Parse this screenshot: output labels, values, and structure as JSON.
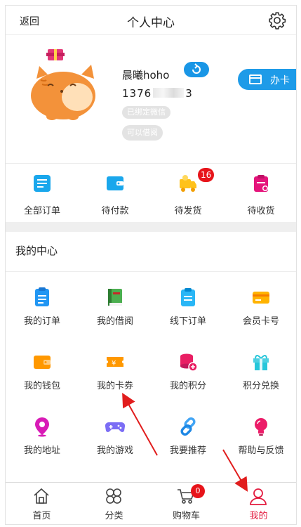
{
  "header": {
    "back_label": "返回",
    "title": "个人中心"
  },
  "profile": {
    "username": "晨曦hoho",
    "phone_prefix": "1376",
    "phone_suffix": "3",
    "tag_wechat": "已绑定微信",
    "tag_borrow": "可以借阅",
    "card_button_label": "办卡"
  },
  "orders": [
    {
      "label": "全部订单",
      "icon": "all-orders-icon",
      "color": "#1aa7ec"
    },
    {
      "label": "待付款",
      "icon": "wallet-icon",
      "color": "#1aa7ec"
    },
    {
      "label": "待发货",
      "icon": "delivery-truck-icon",
      "color": "#ffc21b",
      "badge": "16"
    },
    {
      "label": "待收货",
      "icon": "clipboard-icon",
      "color": "#e5147b"
    }
  ],
  "center": {
    "title": "我的中心",
    "items": [
      {
        "label": "我的订单",
        "icon": "order-list-icon"
      },
      {
        "label": "我的借阅",
        "icon": "book-icon"
      },
      {
        "label": "线下订单",
        "icon": "offline-order-icon"
      },
      {
        "label": "会员卡号",
        "icon": "member-card-icon"
      },
      {
        "label": "我的钱包",
        "icon": "wallet-icon"
      },
      {
        "label": "我的卡券",
        "icon": "coupon-icon"
      },
      {
        "label": "我的积分",
        "icon": "points-icon"
      },
      {
        "label": "积分兑换",
        "icon": "gift-icon"
      },
      {
        "label": "我的地址",
        "icon": "location-icon"
      },
      {
        "label": "我的游戏",
        "icon": "gamepad-icon"
      },
      {
        "label": "我要推荐",
        "icon": "link-icon"
      },
      {
        "label": "帮助与反馈",
        "icon": "lightbulb-icon"
      }
    ]
  },
  "tabbar": {
    "items": [
      {
        "label": "首页",
        "icon": "home-icon"
      },
      {
        "label": "分类",
        "icon": "category-icon"
      },
      {
        "label": "购物车",
        "icon": "cart-icon",
        "badge": "0"
      },
      {
        "label": "我的",
        "icon": "user-icon",
        "active": true
      }
    ]
  },
  "colors": {
    "accent_blue": "#1e9be8",
    "badge_red": "#e7141a",
    "active_tab": "#e31b3f"
  }
}
